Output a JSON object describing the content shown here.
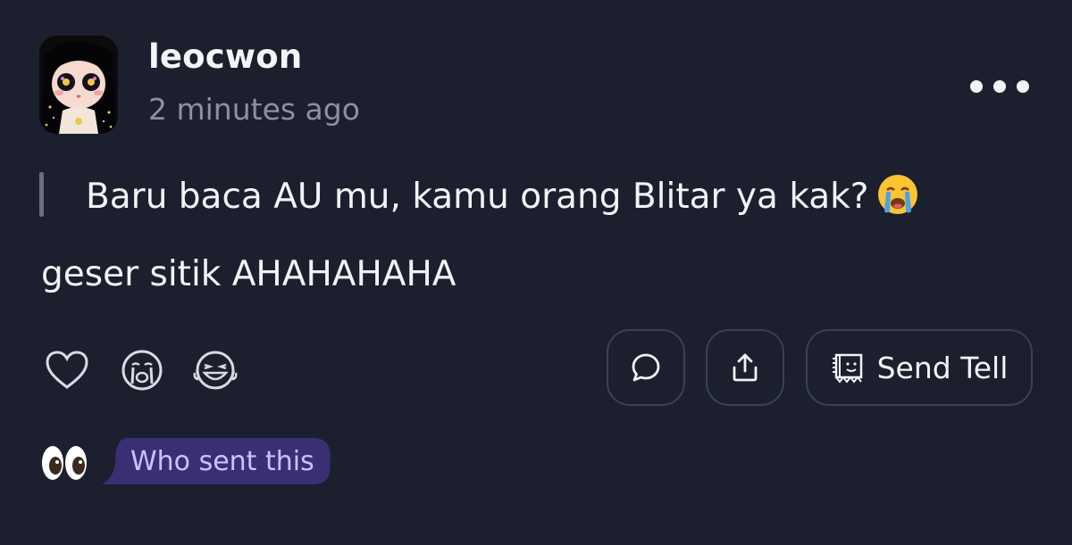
{
  "post": {
    "username": "leocwon",
    "timestamp": "2 minutes ago",
    "quote": "Baru baca AU mu, kamu orang Blitar ya kak?",
    "quote_emoji": "crying-face-emoji",
    "reply": "geser sitik AHAHAHAHA"
  },
  "header": {
    "more_icon": "more-horizontal-icon"
  },
  "reactions": [
    {
      "icon": "heart-outline-icon"
    },
    {
      "icon": "crying-face-outline-icon"
    },
    {
      "icon": "laughing-face-outline-icon"
    }
  ],
  "actions": {
    "comment_icon": "speech-bubble-icon",
    "share_icon": "share-upload-icon",
    "send_tell_label": "Send Tell",
    "send_tell_icon": "tell-card-icon"
  },
  "footer": {
    "eyes_emoji": "eyes-emoji",
    "who_sent_label": "Who sent this"
  },
  "colors": {
    "background": "#1b1f2e",
    "text_primary": "#f2f3f6",
    "text_secondary": "#8c90a0",
    "button_border": "#3b4153",
    "who_sent_bg": "#3a2f73",
    "who_sent_text": "#c9c3ff"
  }
}
